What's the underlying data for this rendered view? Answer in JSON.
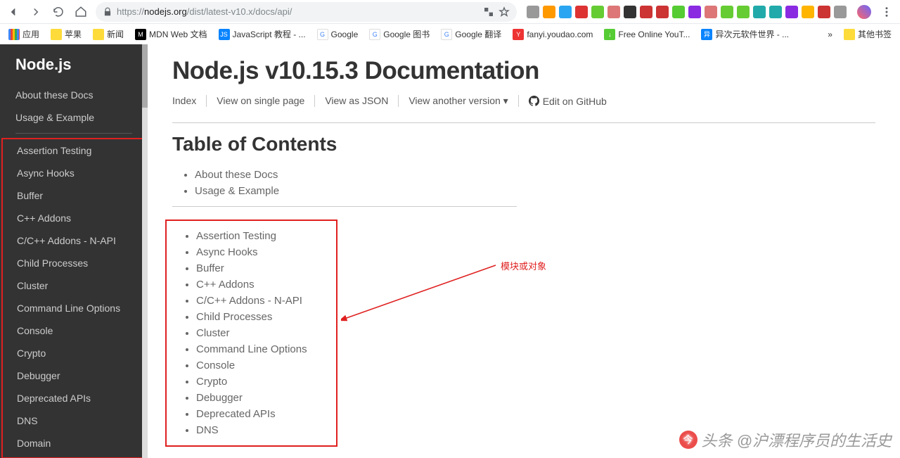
{
  "browser": {
    "url": "https://nodejs.org/dist/latest-v10.x/docs/api/",
    "url_gray_prefix": "https://",
    "url_host": "nodejs.org",
    "url_path": "/dist/latest-v10.x/docs/api/",
    "bookmarks": {
      "apps": "应用",
      "items": [
        {
          "label": "苹果",
          "color": "#fddb3a"
        },
        {
          "label": "新闻",
          "color": "#fddb3a"
        },
        {
          "label": "MDN Web 文档",
          "color": "#000",
          "txt": "M"
        },
        {
          "label": "JavaScript 教程 - ...",
          "color": "#0a84ff",
          "txt": "JS"
        },
        {
          "label": "Google",
          "color": "#fff",
          "txt": "G"
        },
        {
          "label": "Google 图书",
          "color": "#fff",
          "txt": "G"
        },
        {
          "label": "Google 翻译",
          "color": "#fff",
          "txt": "G"
        },
        {
          "label": "fanyi.youdao.com",
          "color": "#e33",
          "txt": "Y"
        },
        {
          "label": "Free Online YouT...",
          "color": "#5c3",
          "txt": "↓"
        },
        {
          "label": "异次元软件世界 - ...",
          "color": "#0a84ff",
          "txt": "异"
        }
      ],
      "more": "»",
      "other": "其他书签"
    },
    "ext_colors": [
      "#999",
      "#ff9900",
      "#2aa5f1",
      "#d33",
      "#6c3",
      "#d77",
      "#333",
      "#c33",
      "#c33",
      "#5c3",
      "#8a2be2",
      "#d77",
      "#6c3",
      "#6c3",
      "#2aa",
      "#2aa",
      "#8a2be2",
      "#ffb400",
      "#c33",
      "#999"
    ]
  },
  "sidebar": {
    "brand": "Node.js",
    "top": [
      "About these Docs",
      "Usage & Example"
    ],
    "modules": [
      "Assertion Testing",
      "Async Hooks",
      "Buffer",
      "C++ Addons",
      "C/C++ Addons - N-API",
      "Child Processes",
      "Cluster",
      "Command Line Options",
      "Console",
      "Crypto",
      "Debugger",
      "Deprecated APIs",
      "DNS",
      "Domain"
    ]
  },
  "content": {
    "title": "Node.js v10.15.3 Documentation",
    "picker": {
      "index": "Index",
      "single": "View on single page",
      "json": "View as JSON",
      "another_version": "View another version ▾",
      "edit": "Edit on GitHub"
    },
    "toc_heading": "Table of Contents",
    "toc_top": [
      "About these Docs",
      "Usage & Example"
    ],
    "toc_modules": [
      "Assertion Testing",
      "Async Hooks",
      "Buffer",
      "C++ Addons",
      "C/C++ Addons - N-API",
      "Child Processes",
      "Cluster",
      "Command Line Options",
      "Console",
      "Crypto",
      "Debugger",
      "Deprecated APIs",
      "DNS"
    ],
    "annotation": "模块或对象"
  },
  "watermark": "头条 @沪漂程序员的生活史"
}
